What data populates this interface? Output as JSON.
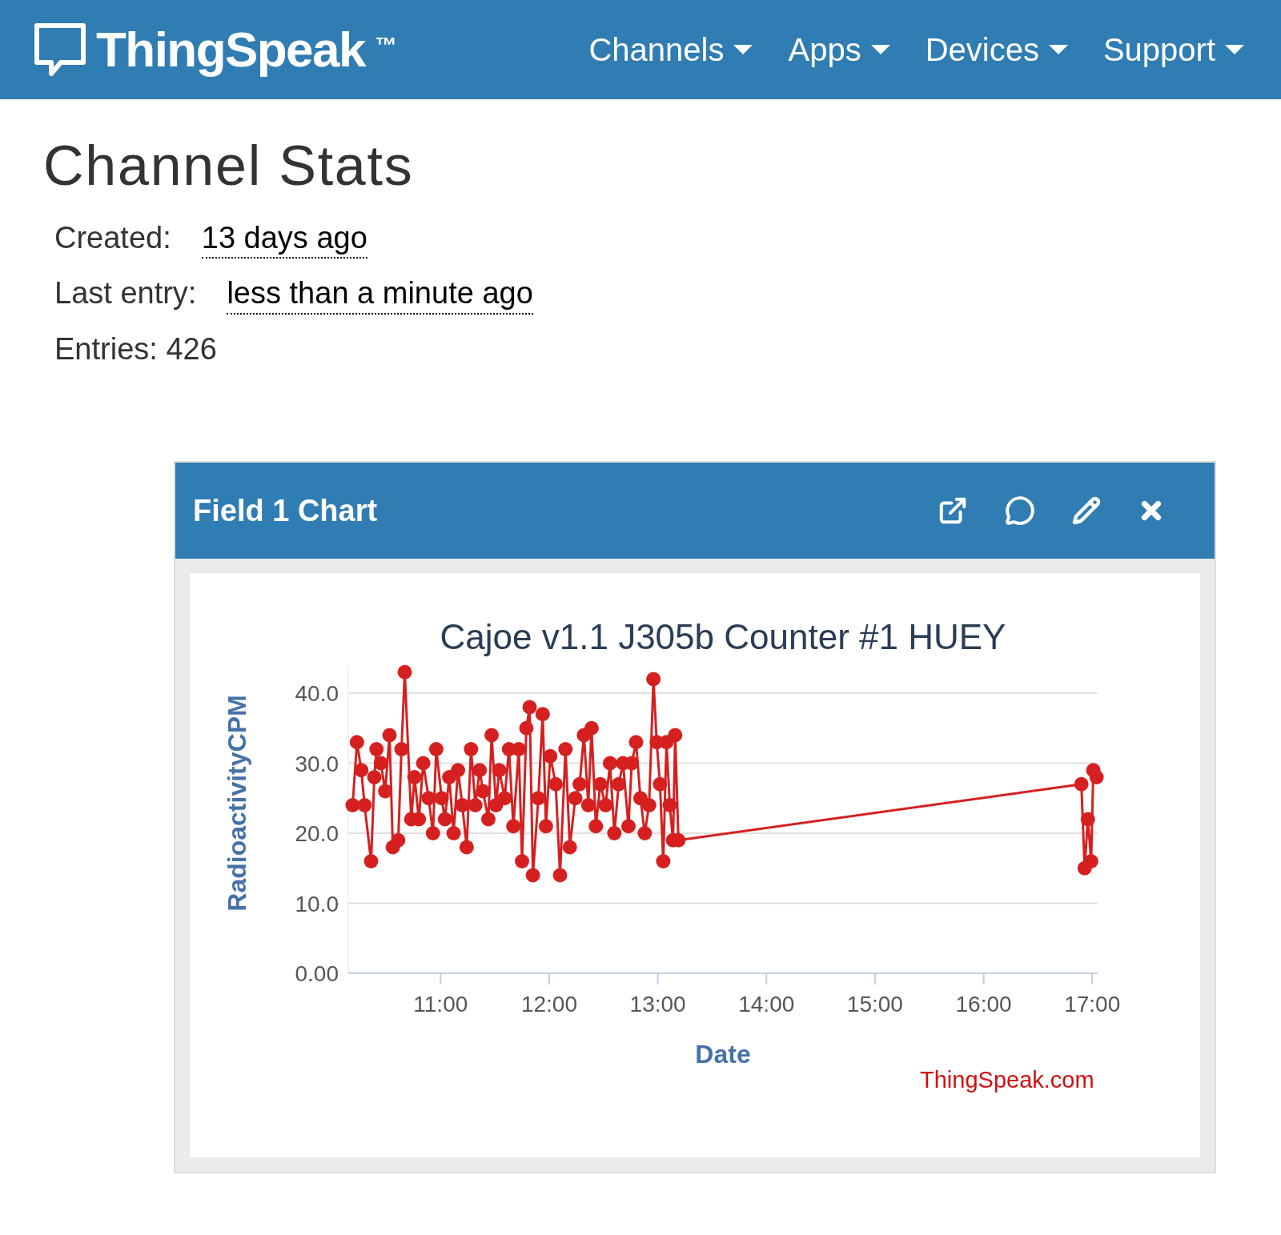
{
  "navbar": {
    "brand": "ThingSpeak",
    "trademark": "™",
    "menus": [
      {
        "label": "Channels"
      },
      {
        "label": "Apps"
      },
      {
        "label": "Devices"
      },
      {
        "label": "Support"
      }
    ]
  },
  "page_title": "Channel Stats",
  "stats": [
    {
      "label": "Created:",
      "value": "13 days ago",
      "kind": "timestamp"
    },
    {
      "label": "Last entry:",
      "value": "less than a minute ago",
      "kind": "timestamp"
    },
    {
      "label": "Entries:",
      "value": "426",
      "kind": "plain"
    }
  ],
  "panel": {
    "title": "Field 1 Chart",
    "credit": "ThingSpeak.com",
    "chart_data": {
      "type": "line",
      "title": "Cajoe v1.1 J305b Counter #1 HUEY",
      "xlabel": "Date",
      "ylabel": "RadioactivityCPM",
      "x": [
        10.19,
        10.23,
        10.27,
        10.3,
        10.36,
        10.39,
        10.41,
        10.45,
        10.49,
        10.53,
        10.56,
        10.61,
        10.64,
        10.67,
        10.73,
        10.76,
        10.8,
        10.84,
        10.89,
        10.93,
        10.96,
        11.01,
        11.04,
        11.08,
        11.12,
        11.16,
        11.2,
        11.24,
        11.28,
        11.32,
        11.36,
        11.39,
        11.44,
        11.47,
        11.51,
        11.54,
        11.59,
        11.63,
        11.67,
        11.72,
        11.75,
        11.79,
        11.82,
        11.85,
        11.9,
        11.94,
        11.97,
        12.01,
        12.06,
        12.1,
        12.15,
        12.19,
        12.24,
        12.28,
        12.32,
        12.36,
        12.39,
        12.43,
        12.47,
        12.52,
        12.56,
        12.6,
        12.64,
        12.68,
        12.73,
        12.76,
        12.8,
        12.84,
        12.88,
        12.92,
        12.96,
        12.99,
        13.02,
        13.05,
        13.08,
        13.11,
        13.14,
        13.16,
        13.19,
        16.9,
        16.93,
        16.96,
        16.99,
        17.01,
        17.04
      ],
      "grid": true,
      "series": [
        {
          "color": "#d62020",
          "marker": "circle",
          "values": [
            24,
            33,
            29,
            24,
            16,
            28,
            32,
            30,
            26,
            34,
            18,
            19,
            32,
            43,
            22,
            28,
            22,
            30,
            25,
            20,
            32,
            25,
            22,
            28,
            20,
            29,
            24,
            18,
            32,
            24,
            29,
            26,
            22,
            34,
            24,
            29,
            25,
            32,
            21,
            32,
            16,
            35,
            38,
            14,
            25,
            37,
            21,
            31,
            27,
            14,
            32,
            18,
            25,
            27,
            34,
            24,
            35,
            21,
            27,
            24,
            30,
            20,
            27,
            30,
            21,
            30,
            33,
            25,
            20,
            24,
            42,
            33,
            27,
            16,
            33,
            24,
            19,
            34,
            19,
            27,
            15,
            22,
            16,
            29,
            28
          ]
        }
      ],
      "xlim": [
        10.15,
        17.05
      ],
      "ylim": [
        0,
        44
      ],
      "xticks": [
        {
          "value": 11,
          "label": "11:00"
        },
        {
          "value": 12,
          "label": "12:00"
        },
        {
          "value": 13,
          "label": "13:00"
        },
        {
          "value": 14,
          "label": "14:00"
        },
        {
          "value": 15,
          "label": "15:00"
        },
        {
          "value": 16,
          "label": "16:00"
        },
        {
          "value": 17,
          "label": "17:00"
        }
      ],
      "yticks": [
        {
          "value": 0,
          "label": "0.00"
        },
        {
          "value": 10,
          "label": "10.0"
        },
        {
          "value": 20,
          "label": "20.0"
        },
        {
          "value": 30,
          "label": "30.0"
        },
        {
          "value": 40,
          "label": "40.0"
        }
      ]
    }
  }
}
